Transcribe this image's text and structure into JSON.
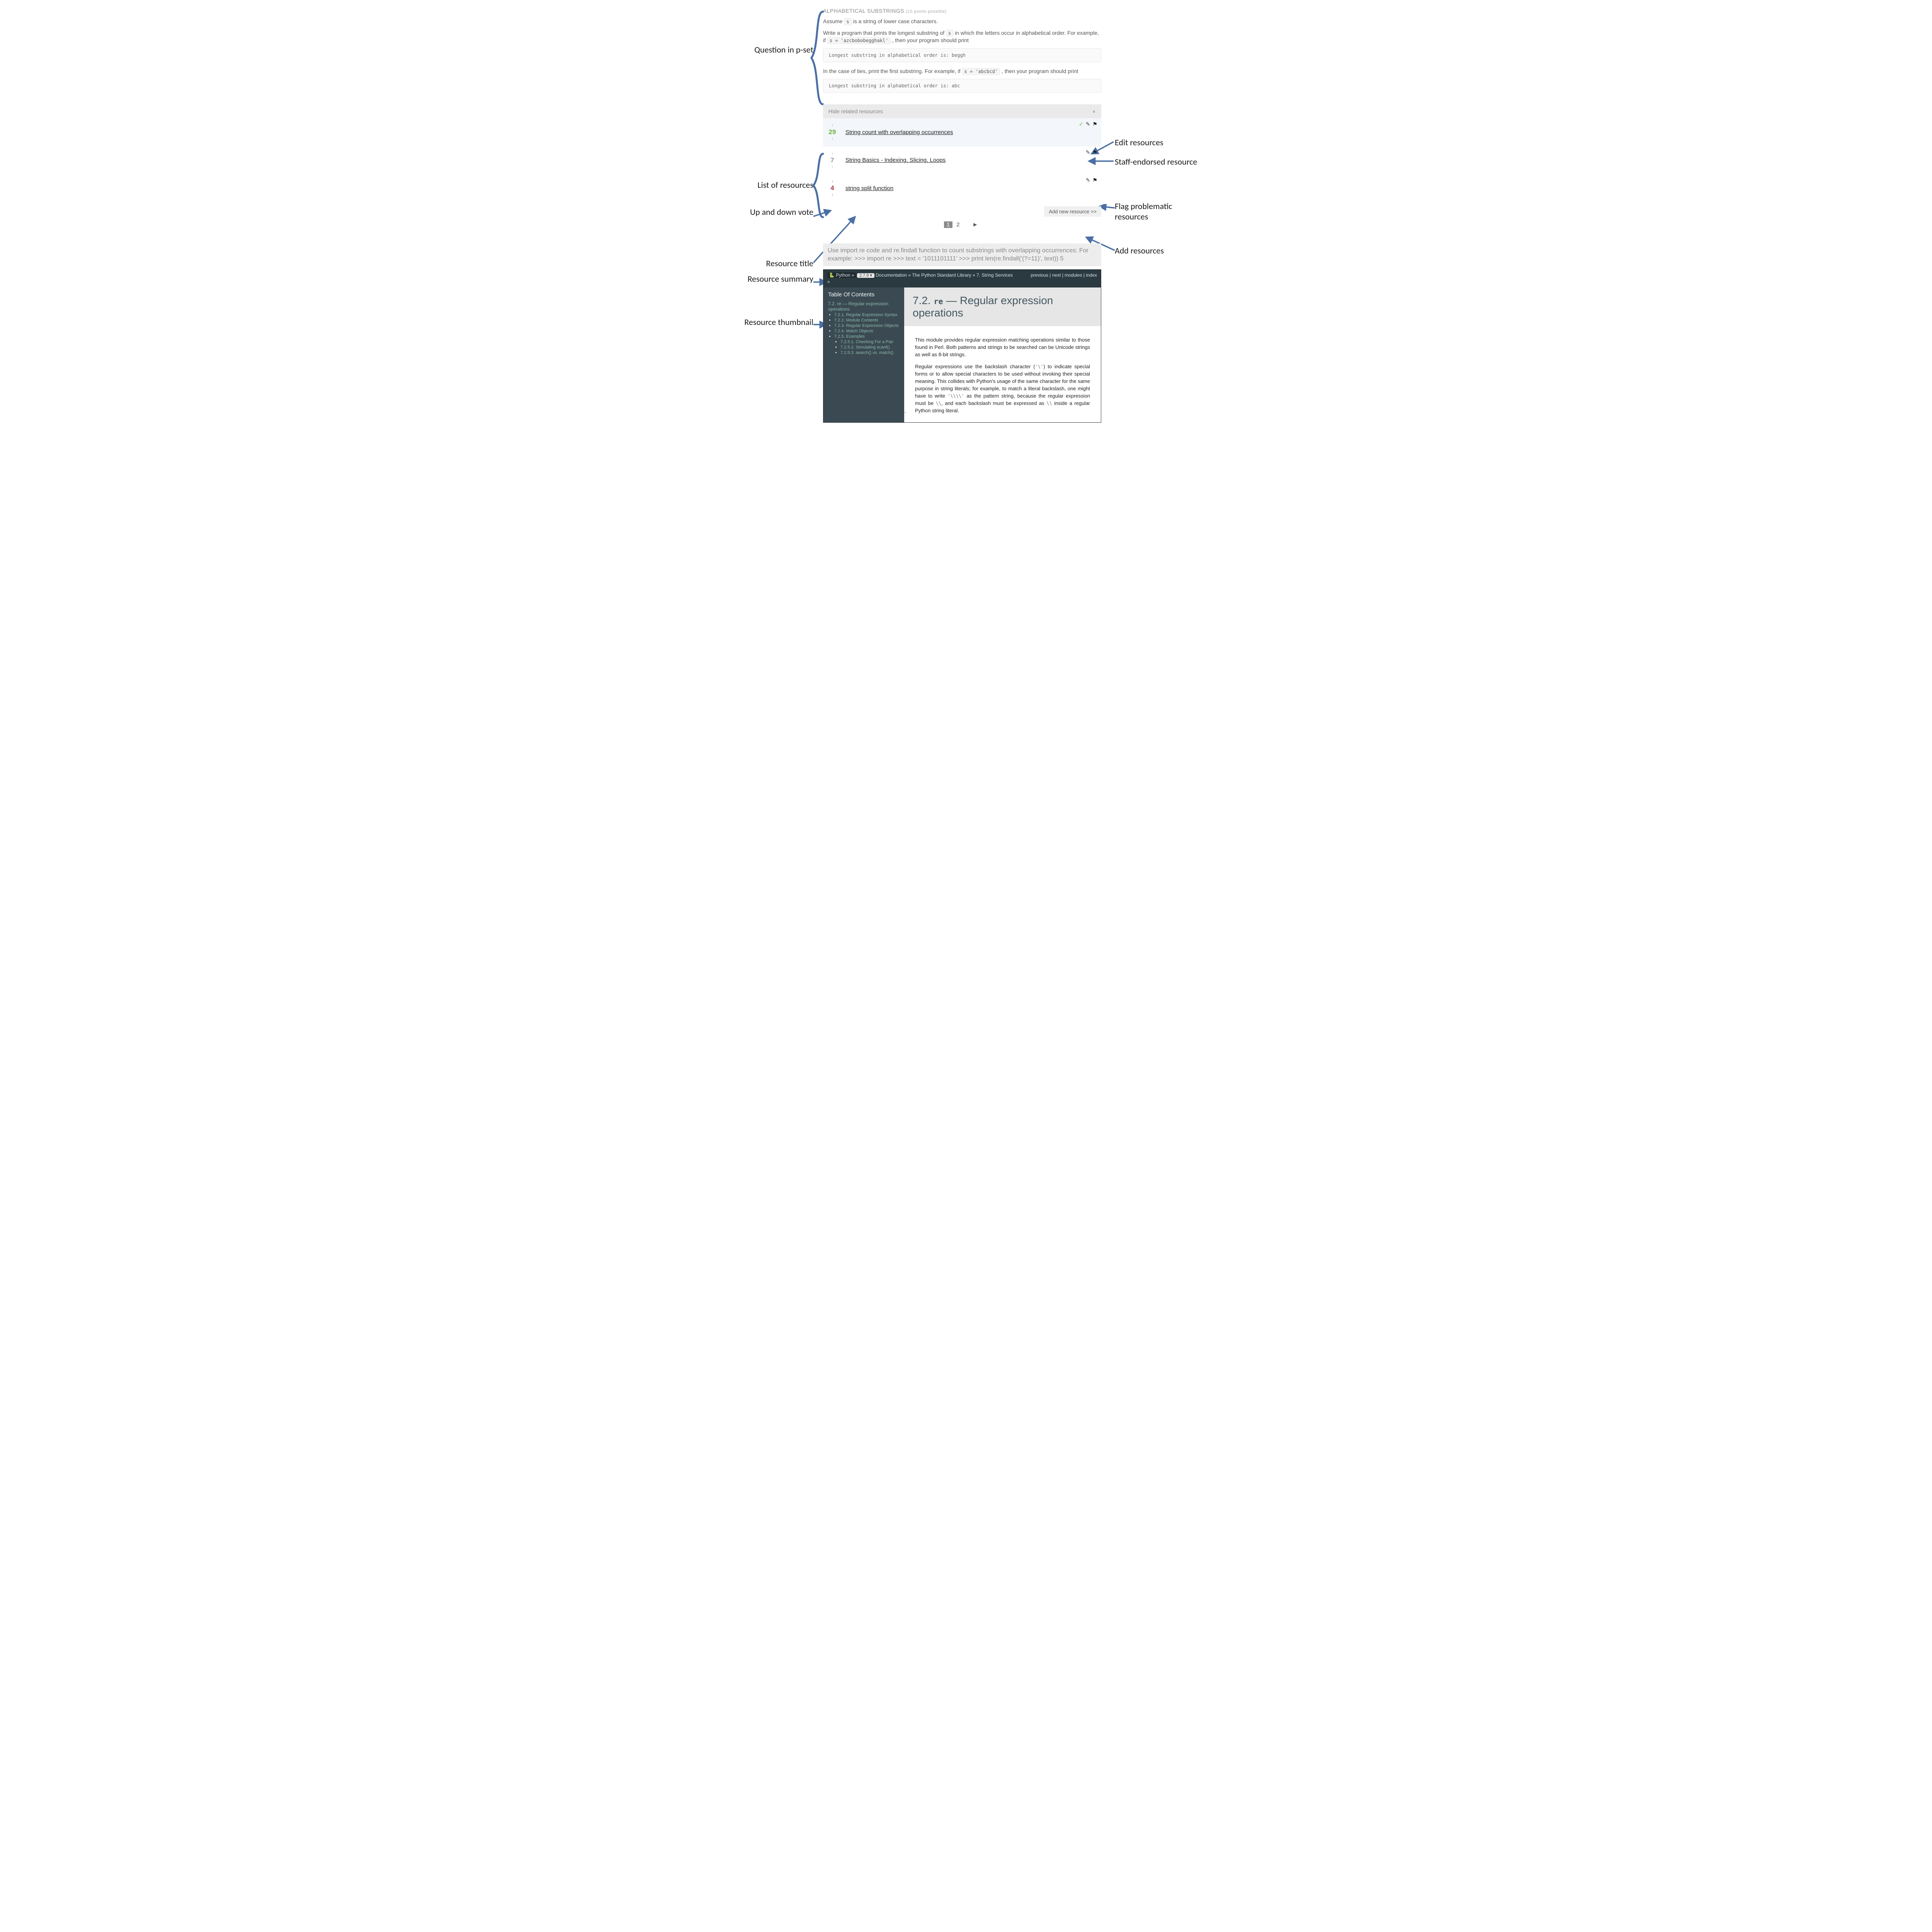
{
  "question": {
    "title": "ALPHABETICAL SUBSTRINGS",
    "points_label": "(15 points possible)",
    "para1_pre": "Assume ",
    "para1_code": "s",
    "para1_post": " is a string of lower case characters.",
    "para2_pre": "Write a program that prints the longest substring of ",
    "para2_code": "s",
    "para2_mid": " in which the letters occur in alphabetical order. For example, if ",
    "para2_code2": "s = 'azcbobobegghakl'",
    "para2_post": " , then your program should print",
    "code1": "Longest substring in alphabetical order is: beggh",
    "para3_pre": "In the case of ties, print the first substring. For example, if ",
    "para3_code": "s = 'abcbcd'",
    "para3_post": " , then your program should print",
    "code2": "Longest substring in alphabetical order is: abc"
  },
  "resources_header": "Hide related resources",
  "resources": {
    "items": [
      {
        "votes": "29",
        "color": "green",
        "title": "String count with overlapping occurrences",
        "highlight": true,
        "endorsed": true,
        "edit": true,
        "flag": true
      },
      {
        "votes": "7",
        "color": "grey",
        "title": "String Basics - Indexing, Slicing, Loops",
        "highlight": false,
        "endorsed": false,
        "edit": true,
        "flag": true
      },
      {
        "votes": "4",
        "color": "red",
        "title": "string split function",
        "highlight": false,
        "endorsed": false,
        "edit": true,
        "flag": true
      }
    ]
  },
  "add_button": "Add new resource >>",
  "pager": {
    "current": "1",
    "other": "2",
    "next": "►"
  },
  "summary": "Use import re code and re.findall function to count substrings with overlapping occurrences: For example: >>> import re >>> text = '1011101111' >>> print len(re.findall('(?=11)', text)) 5",
  "thumb": {
    "python_label": "Python",
    "version": "2.7.9",
    "breadcrumb": " Documentation » The Python Standard Library » 7. String Services",
    "toplinks": "previous | next | modules | index",
    "trail": "»",
    "toc_title": "Table Of Contents",
    "toc_head": "7.2. re — Regular expression operations",
    "toc": [
      "7.2.1. Regular Expression Syntax",
      "7.2.2. Module Contents",
      "7.2.3. Regular Expression Objects",
      "7.2.4. Match Objects",
      "7.2.5. Examples"
    ],
    "toc_sub": [
      "7.2.5.1. Checking For a Pair",
      "7.2.5.2. Simulating scanf()",
      "7.2.5.3. search() vs. match()"
    ],
    "h2_pre": "7.2. ",
    "h2_code": "re",
    "h2_post": " — Regular expression operations",
    "p1": "This module provides regular expression matching operations similar to those found in Perl. Both patterns and strings to be searched can be Unicode strings as well as 8-bit strings.",
    "p2a": "Regular expressions use the backslash character (",
    "p2code1": "'\\'",
    "p2b": ") to indicate special forms or to allow special characters to be used without invoking their special meaning. This collides with Python's usage of the same character for the same purpose in string literals; for example, to match a literal backslash, one might have to write ",
    "p2code2": "'\\\\\\\\'",
    "p2c": " as the pattern string, because the regular expression must be ",
    "p2code3": "\\\\",
    "p2d": ", and each backslash must be expressed as ",
    "p2code4": "\\\\",
    "p2e": " inside a regular Python string literal."
  },
  "annotations": {
    "question": "Question in p-set",
    "list": "List of resources",
    "vote": "Up and down vote",
    "title": "Resource title",
    "rsummary": "Resource summary",
    "rthumb": "Resource thumbnail",
    "edit": "Edit resources",
    "staff": "Staff-endorsed resource",
    "flag_line1": "Flag  problematic",
    "flag_line2": "resources",
    "add": "Add resources"
  }
}
